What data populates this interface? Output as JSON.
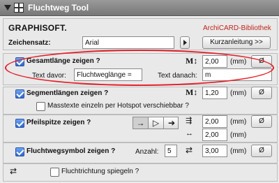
{
  "window": {
    "title": "Fluchtweg Tool"
  },
  "brand": {
    "logo_text": "GRAPHISOFT.",
    "library_label": "ArchiCARD-Bibliothek"
  },
  "font_row": {
    "label": "Zeichensatz:",
    "value": "Arial",
    "manual_button": "Kurzanleitung >>"
  },
  "total_length": {
    "label": "Gesamtlänge zeigen ?",
    "checked": true,
    "icon": "M↕",
    "value": "2,00",
    "unit": "(mm)",
    "diameter_symbol": "Ø",
    "text_before_label": "Text davor:",
    "text_before_value": "Fluchtweglänge =",
    "text_after_label": "Text danach:",
    "text_after_value": "m"
  },
  "segment_lengths": {
    "label": "Segmentlängen zeigen ?",
    "checked": true,
    "icon": "M↕",
    "value": "1,20",
    "unit": "(mm)",
    "diameter_symbol": "Ø",
    "hotspot_label": "Masstexte einzeln per Hotspot verschiebbar ?",
    "hotspot_checked": false
  },
  "arrow_tip": {
    "label": "Pfeilspitze zeigen ?",
    "checked": true,
    "styles": [
      "→",
      "▷",
      "➔"
    ],
    "selected_style_index": 0,
    "value_1": "2,00",
    "value_2": "2,00",
    "unit": "(mm)",
    "diameter_symbol": "Ø"
  },
  "escape_symbol": {
    "label": "Fluchtwegsymbol zeigen ?",
    "checked": true,
    "count_label": "Anzahl:",
    "count_value": "5",
    "value": "3,00",
    "unit": "(mm)",
    "diameter_symbol": "Ø"
  },
  "mirror": {
    "label": "Fluchtrichtung spiegeln ?",
    "checked": false
  },
  "colors": {
    "highlight_oval": "#e5202a",
    "accent_red": "#c0241a",
    "checkbox_blue": "#2f67c9"
  }
}
